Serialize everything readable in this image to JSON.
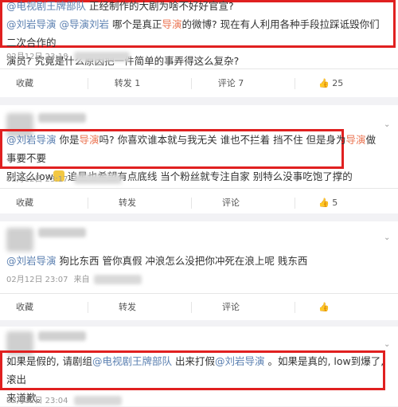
{
  "post1": {
    "mention_a": "@电视剧王牌部队",
    "text_a": " 正经制作的大剧为啥不好好官宣?",
    "mention_b": "@刘岩导演",
    "mention_c": "@导演刘岩",
    "text_b": " 哪个是真正",
    "inline_red_1": "导演",
    "text_c": "的微博? 现在有人利用各种手段拉踩诋毁你们二次合作的",
    "text_d": "演员? 究竟是什么原因把一件简单的事弄得这么复杂?",
    "meta": "02月12日 23:18",
    "actions": {
      "collect": "收藏",
      "repost": "转发 1",
      "comment": "评论 7",
      "like": "25"
    }
  },
  "post2": {
    "mention_a": "@刘岩导演",
    "text_a": " 你是",
    "inline_red_1": "导演",
    "text_b": "吗? 你喜欢谁本就与我无关 谁也不拦着 挡不住 但是身为",
    "inline_red_2": "导演",
    "text_c": "做事要不要",
    "text_d": "别这么low",
    "text_e": " 追星也希望有点底线 当个粉丝就专注自家 别特么没事吃饱了撑的",
    "meta": "02月12日 23:17",
    "actions": {
      "collect": "收藏",
      "repost": "转发",
      "comment": "评论",
      "like": "5"
    }
  },
  "post3": {
    "mention_a": "@刘岩导演",
    "text_a": " 狗比东西 管你真假 冲浪怎么没把你冲死在浪上呢 贱东西",
    "meta": "02月12日 23:07",
    "meta_from": "来自",
    "actions": {
      "collect": "收藏",
      "repost": "转发",
      "comment": "评论",
      "like": ""
    }
  },
  "post4": {
    "text_a": "如果是假的, 请剧组",
    "mention_a": "@电视剧王牌部队",
    "text_b": " 出来打假",
    "mention_b": "@刘岩导演",
    "text_c": " 。如果是真的, low到爆了, 滚出",
    "text_d": "来道歉。",
    "meta": "02月12日 23:04"
  }
}
